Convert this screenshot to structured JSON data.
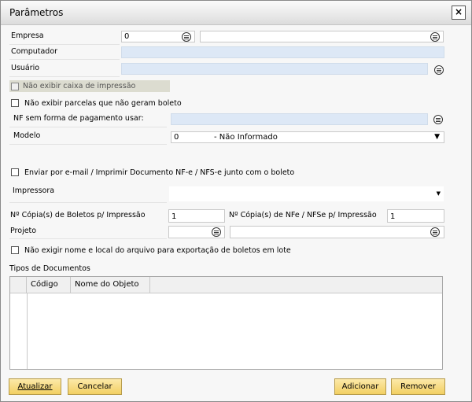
{
  "window": {
    "title": "Parâmetros",
    "close_glyph": "×"
  },
  "fields": {
    "empresa": {
      "label": "Empresa",
      "code": "0",
      "name": ""
    },
    "computador": {
      "label": "Computador",
      "value": ""
    },
    "usuario": {
      "label": "Usuário",
      "value": ""
    },
    "nao_exibir_caixa": {
      "label": "Não exibir caixa de impressão",
      "checked": false
    },
    "nao_exibir_parcelas": {
      "label": "Não exibir parcelas que não geram boleto",
      "checked": false
    },
    "nf_sem_forma": {
      "label": "NF sem forma de pagamento usar:",
      "value": ""
    },
    "modelo": {
      "label": "Modelo",
      "code": "0",
      "value": "- Não Informado"
    },
    "enviar_email": {
      "label": "Enviar por e-mail / Imprimir Documento NF-e / NFS-e junto com o boleto",
      "checked": false
    },
    "impressora": {
      "label": "Impressora",
      "value": ""
    },
    "copias_boletos": {
      "label": "Nº Cópia(s) de Boletos p/ Impressão",
      "value": "1"
    },
    "copias_nfe": {
      "label": "Nº Cópia(s) de NFe / NFSe p/ Impressão",
      "value": "1"
    },
    "projeto": {
      "label": "Projeto",
      "code": "",
      "name": ""
    },
    "nao_exigir_nome": {
      "label": "Não exigir nome e local do arquivo para exportação de boletos em lote",
      "checked": false
    }
  },
  "tipos_documentos": {
    "label": "Tipos de Documentos",
    "columns": [
      "",
      "Código",
      "Nome do Objeto"
    ],
    "rows": []
  },
  "buttons": {
    "atualizar": "Atualizar",
    "cancelar": "Cancelar",
    "adicionar": "Adicionar",
    "remover": "Remover"
  },
  "icons": {
    "picker": "list-picker-icon",
    "dropdown": "dropdown-arrow-icon",
    "close": "close-icon",
    "checkbox": "checkbox-icon"
  },
  "colors": {
    "readonly_field": "#dde8f6",
    "button": "#f2cf62",
    "window_bg": "#f7f7f7"
  }
}
